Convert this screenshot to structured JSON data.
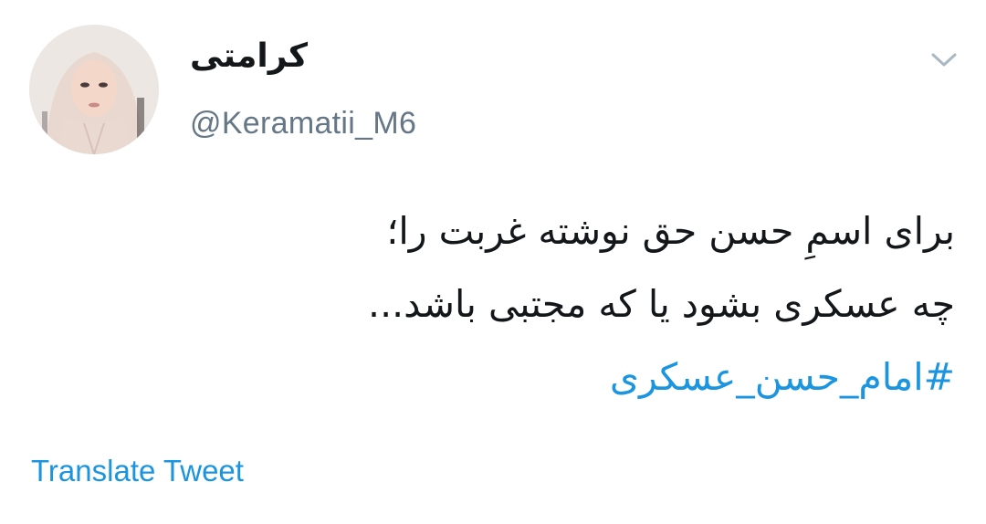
{
  "tweet": {
    "author": {
      "display_name": "کرامتی",
      "handle": "@Keramatii_M6"
    },
    "menu_icon": "chevron-down-icon",
    "text_lines": [
      "برای اسمِ حسن حق نوشته غربت را؛",
      "چه عسکری بشود یا که مجتبی باشد..."
    ],
    "hashtag": "#امام_حسن_عسکری",
    "translate_label": "Translate Tweet"
  },
  "colors": {
    "link": "#1b95e0",
    "secondary_text": "#657786",
    "primary_text": "#14171a"
  }
}
